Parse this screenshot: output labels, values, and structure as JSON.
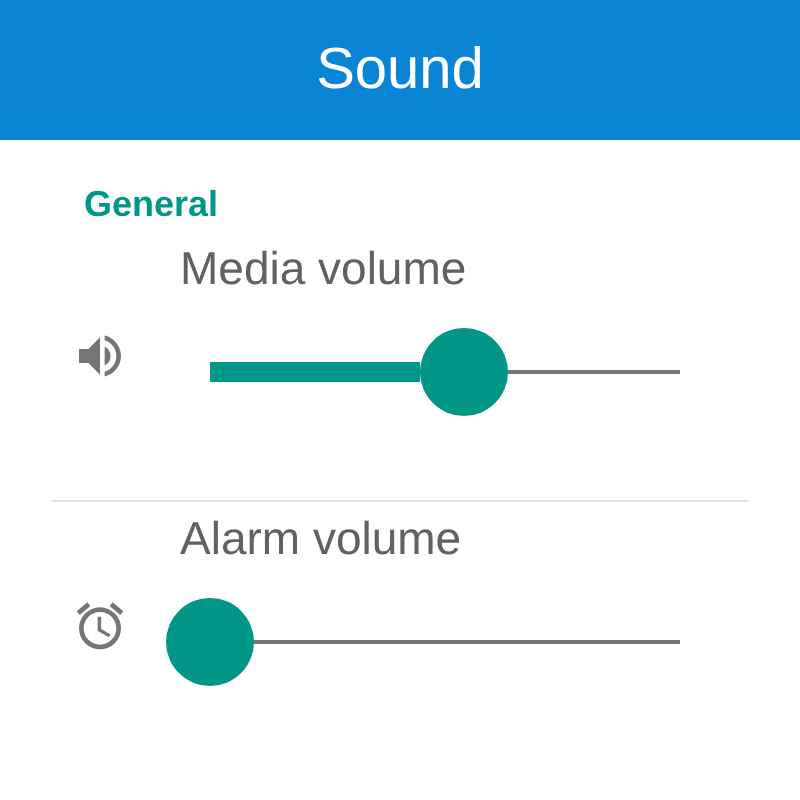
{
  "app_bar": {
    "title": "Sound"
  },
  "section": {
    "title": "General"
  },
  "settings": [
    {
      "label": "Media volume",
      "level": 0.54
    },
    {
      "label": "Alarm volume",
      "level": 0
    }
  ]
}
